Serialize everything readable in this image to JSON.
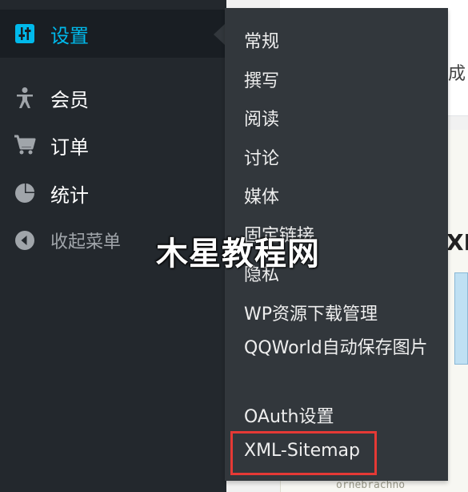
{
  "admin_menu": {
    "current_label": "设置",
    "items": [
      {
        "label": "会员",
        "icon": "person-icon"
      },
      {
        "label": "订单",
        "icon": "cart-icon"
      },
      {
        "label": "统计",
        "icon": "pie-chart-icon"
      }
    ],
    "collapse_label": "收起菜单"
  },
  "submenu": {
    "items": [
      "常规",
      "撰写",
      "阅读",
      "讨论",
      "媒体",
      "固定链接",
      "隐私",
      "WP资源下载管理",
      "QQWorld自动保存图片",
      "OAuth设置",
      "XML-Sitemap"
    ]
  },
  "background": {
    "cut_text": "成",
    "image_letters": "XM",
    "image_scribble": "ornebrachno"
  },
  "watermark": "木星教程网",
  "colors": {
    "menu_bg": "#23282d",
    "current_bg": "#191e23",
    "submenu_bg": "#32373c",
    "accent": "#00b9eb",
    "highlight": "#e53935"
  }
}
